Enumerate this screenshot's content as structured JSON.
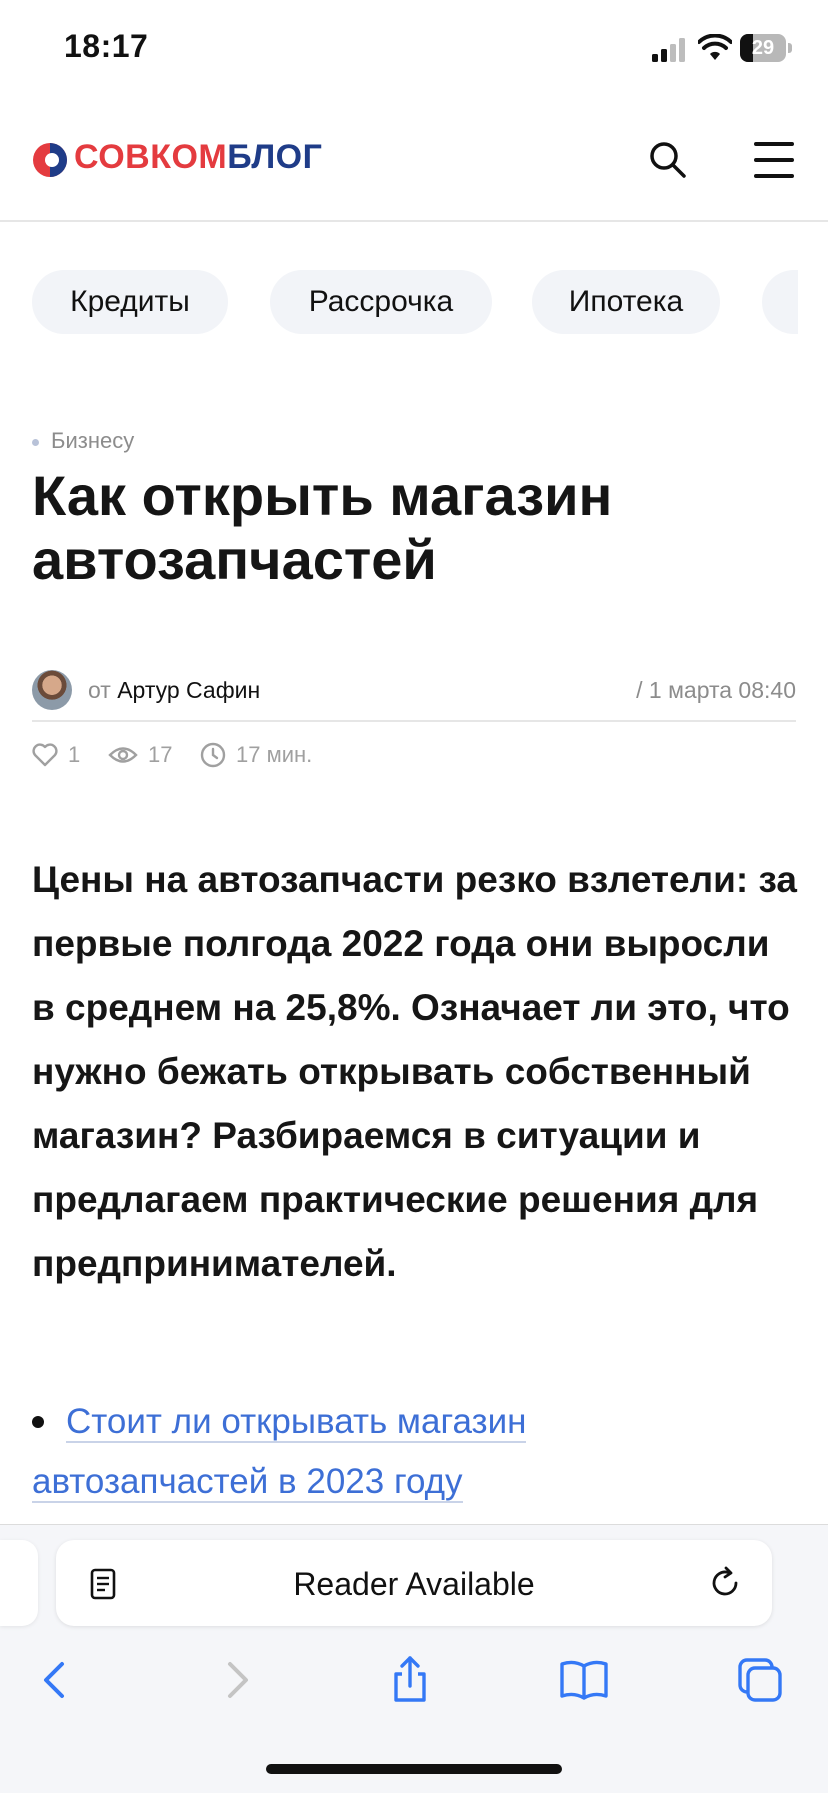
{
  "status_bar": {
    "time": "18:17",
    "battery": "29",
    "battery_level": 0.29
  },
  "header": {
    "logo_part1": "СОВКОМ",
    "logo_part2": "БЛОГ",
    "icons": [
      "search-icon",
      "menu-icon"
    ]
  },
  "categories": [
    "Кредиты",
    "Рассрочка",
    "Ипотека"
  ],
  "article": {
    "breadcrumb": "Бизнесу",
    "title": "Как открыть магазин автозапчастей",
    "author_prefix": "от",
    "author_name": "Артур Сафин",
    "date": "/ 1 марта 08:40",
    "likes": "1",
    "views": "17",
    "read_time": "17 мин.",
    "lead": "Цены на автозапчасти резко взлетели: за первые полгода 2022 года они выросли в среднем на 25,8%. Означает ли это, что нужно бежать открывать собственный магазин? Разбираемся в ситуации и предлагаем практические решения для предпринимателей.",
    "toc": [
      "Стоит ли открывать магазин автозапчастей в 2023 году"
    ]
  },
  "browser": {
    "address_text": "Reader Available",
    "toolbar_icons": [
      "back-icon",
      "forward-icon",
      "share-icon",
      "bookmarks-icon",
      "tabs-icon"
    ]
  },
  "colors": {
    "brand_red": "#e43b3f",
    "brand_blue": "#1f3c88",
    "link": "#3d6fd6"
  }
}
